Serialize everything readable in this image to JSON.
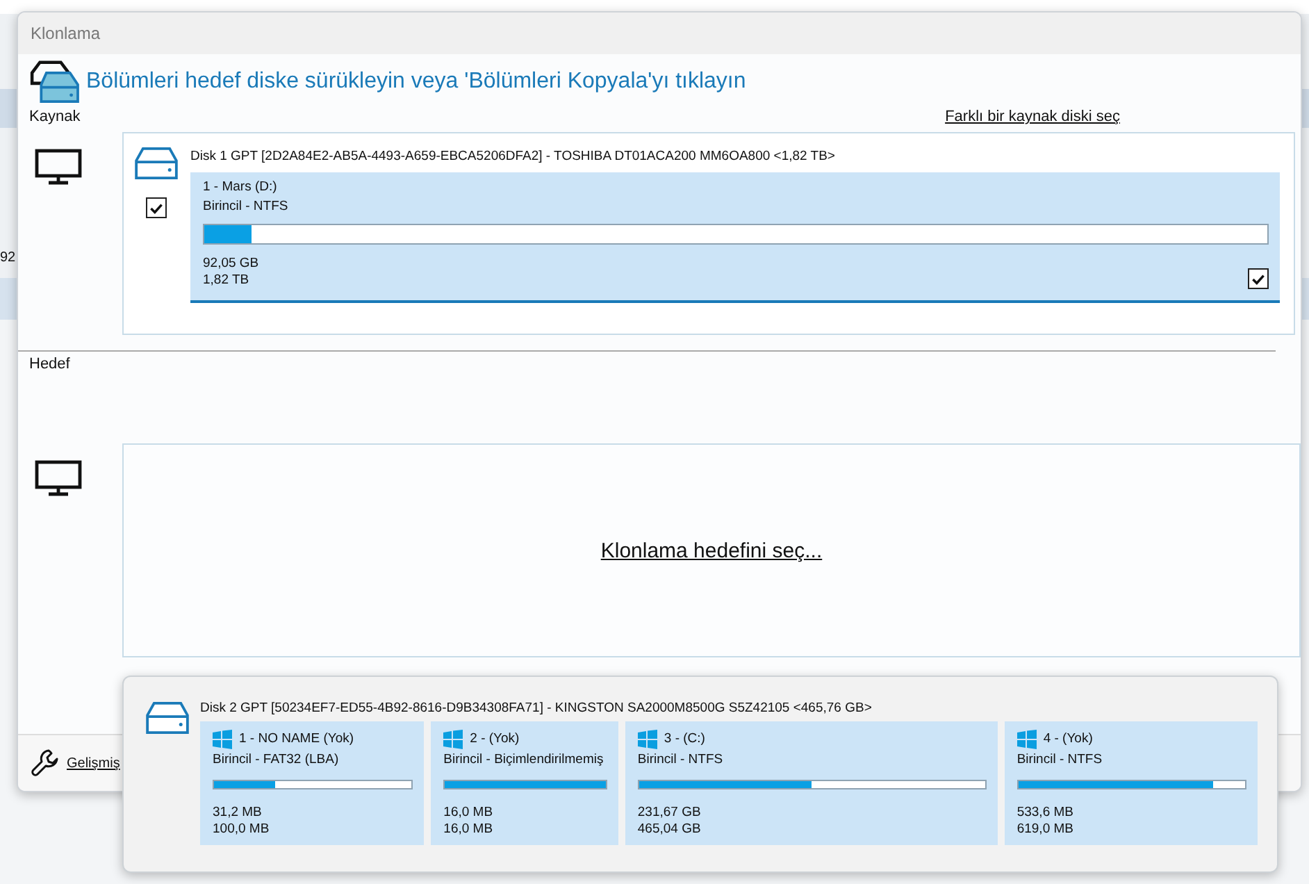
{
  "background": {
    "fragment": "92"
  },
  "window": {
    "title": "Klonlama"
  },
  "heading": "Bölümleri hedef diske sürükleyin veya 'Bölümleri Kopyala'yı tıklayın",
  "source": {
    "label": "Kaynak",
    "link": "Farklı bir kaynak diski seç",
    "disk": {
      "label": "Disk 1 GPT [2D2A84E2-AB5A-4493-A659-EBCA5206DFA2] - TOSHIBA DT01ACA200 MM6OA800  <1,82 TB>",
      "checked": true,
      "partitions": [
        {
          "name": "1 - Mars (D:)",
          "type": "Birincil - NTFS",
          "level": 0.045,
          "used": "92,05 GB",
          "total": "1,82 TB",
          "checked": true,
          "selected": true
        }
      ]
    }
  },
  "target": {
    "label": "Hedef",
    "link": "Klonlama hedefini seç..."
  },
  "footer": {
    "link": "Gelişmiş"
  },
  "popup": {
    "disk": {
      "label": "Disk 2 GPT [50234EF7-ED55-4B92-8616-D9B34308FA71] - KINGSTON SA2000M8500G S5Z42105  <465,76 GB>",
      "partitions": [
        {
          "name": "1 - NO NAME (Yok)",
          "type": "Birincil - FAT32 (LBA)",
          "level": 0.31,
          "used": "31,2 MB",
          "total": "100,0 MB"
        },
        {
          "name": "2 -  (Yok)",
          "type": "Birincil - Biçimlendirilmemiş",
          "level": 1,
          "used": "16,0 MB",
          "total": "16,0 MB"
        },
        {
          "name": "3 -  (C:)",
          "type": "Birincil - NTFS",
          "level": 0.498,
          "used": "231,67 GB",
          "total": "465,04 GB"
        },
        {
          "name": "4 -  (Yok)",
          "type": "Birincil - NTFS",
          "level": 0.862,
          "used": "533,6 MB",
          "total": "619,0 MB"
        }
      ]
    }
  }
}
